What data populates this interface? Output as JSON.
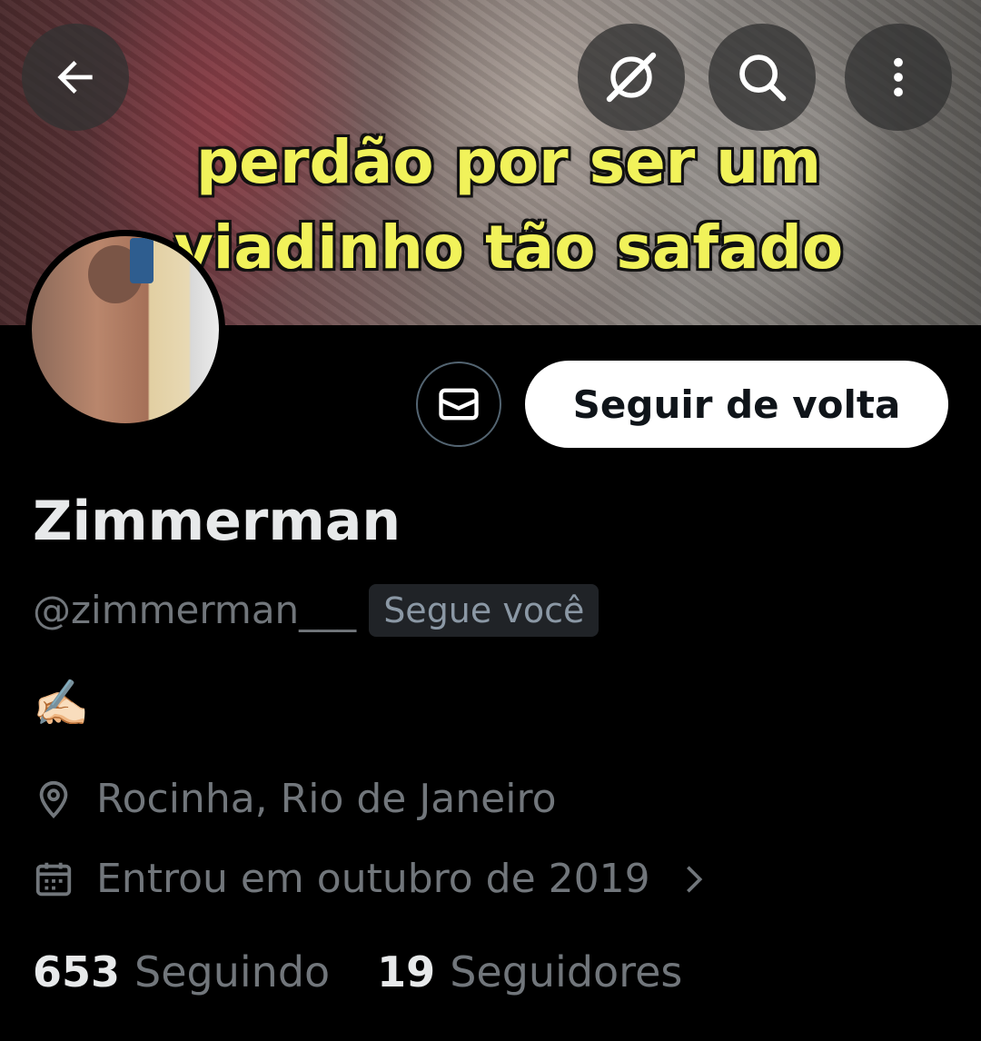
{
  "header": {
    "banner_caption_line1": "perdão por ser um",
    "banner_caption_line2": "viadinho tão safado",
    "back_icon": "arrow-left-icon",
    "grok_icon": "grok-icon",
    "search_icon": "search-icon",
    "more_icon": "more-vertical-icon"
  },
  "profile": {
    "name": "Zimmerman",
    "handle": "@zimmerman___",
    "follows_you_badge": "Segue você",
    "bio": "✍🏻",
    "location": "Rocinha, Rio de Janeiro",
    "joined": "Entrou em outubro de 2019"
  },
  "actions": {
    "message_icon": "mail-icon",
    "follow_back_label": "Seguir de volta"
  },
  "stats": {
    "following_count": "653",
    "following_label": "Seguindo",
    "followers_count": "19",
    "followers_label": "Seguidores"
  }
}
